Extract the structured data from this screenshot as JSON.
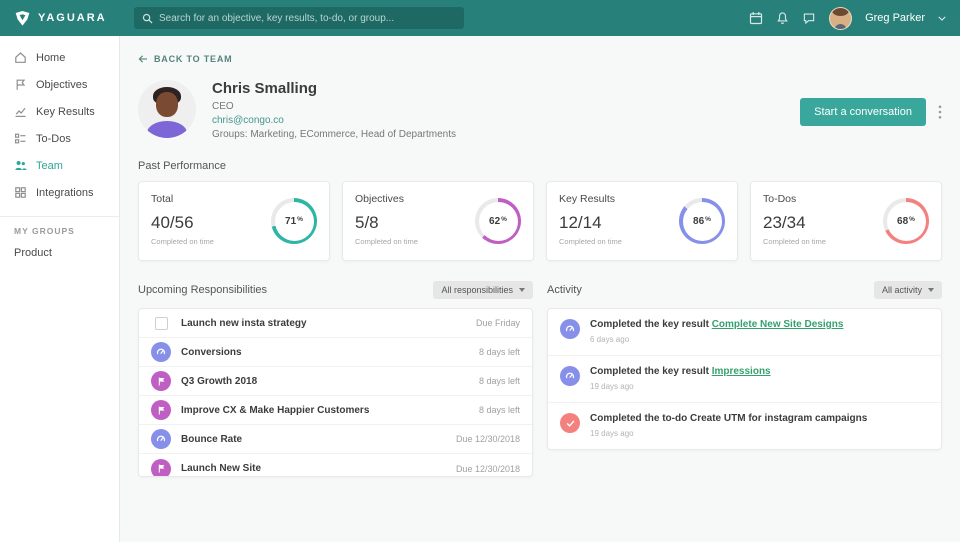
{
  "topbar": {
    "brand": "YAGUARA",
    "search_placeholder": "Search for an objective, key results, to-do, or group...",
    "user_name": "Greg Parker"
  },
  "sidebar": {
    "items": [
      {
        "label": "Home"
      },
      {
        "label": "Objectives"
      },
      {
        "label": "Key Results"
      },
      {
        "label": "To-Dos"
      },
      {
        "label": "Team"
      },
      {
        "label": "Integrations"
      }
    ],
    "groups_header": "MY GROUPS",
    "groups": [
      {
        "label": "Product"
      }
    ]
  },
  "profile": {
    "back_label": "BACK TO TEAM",
    "name": "Chris Smalling",
    "role": "CEO",
    "email": "chris@congo.co",
    "groups_line": "Groups: Marketing, ECommerce, Head of Departments",
    "action_label": "Start a conversation"
  },
  "past_performance": {
    "title": "Past Performance",
    "percent_sign": "%",
    "cards": [
      {
        "label": "Total",
        "value": "40/56",
        "caption": "Completed on time",
        "percent": 71,
        "color": "#2eb5a5"
      },
      {
        "label": "Objectives",
        "value": "5/8",
        "caption": "Completed on time",
        "percent": 62,
        "color": "#c05fc3"
      },
      {
        "label": "Key Results",
        "value": "12/14",
        "caption": "Completed on time",
        "percent": 86,
        "color": "#8690e8"
      },
      {
        "label": "To-Dos",
        "value": "23/34",
        "caption": "Completed on time",
        "percent": 68,
        "color": "#f3827f"
      }
    ]
  },
  "responsibilities": {
    "title": "Upcoming Responsibilities",
    "filter_label": "All responsibilities",
    "items": [
      {
        "label": "Launch new insta strategy",
        "due": "Due Friday",
        "icon": "checkbox",
        "color": ""
      },
      {
        "label": "Conversions",
        "due": "8 days left",
        "icon": "key-result",
        "color": "#8690e8"
      },
      {
        "label": "Q3 Growth 2018",
        "due": "8 days left",
        "icon": "objective",
        "color": "#c05fc3"
      },
      {
        "label": "Improve CX & Make Happier Customers",
        "due": "8 days left",
        "icon": "objective",
        "color": "#c05fc3"
      },
      {
        "label": "Bounce Rate",
        "due": "Due 12/30/2018",
        "icon": "key-result",
        "color": "#8690e8"
      },
      {
        "label": "Launch New Site",
        "due": "Due 12/30/2018",
        "icon": "objective",
        "color": "#c05fc3"
      }
    ]
  },
  "activity": {
    "title": "Activity",
    "filter_label": "All activity",
    "items": [
      {
        "text": "Completed the key result",
        "link": "Complete New Site Designs",
        "time": "6 days ago",
        "icon": "key-result",
        "color": "#8690e8"
      },
      {
        "text": "Completed the key result",
        "link": "Impressions",
        "time": "19 days ago",
        "icon": "key-result",
        "color": "#8690e8"
      },
      {
        "text": "Completed the to-do Create UTM for instagram campaigns",
        "link": "",
        "time": "19 days ago",
        "icon": "todo-check",
        "color": "#f3827f"
      }
    ]
  }
}
